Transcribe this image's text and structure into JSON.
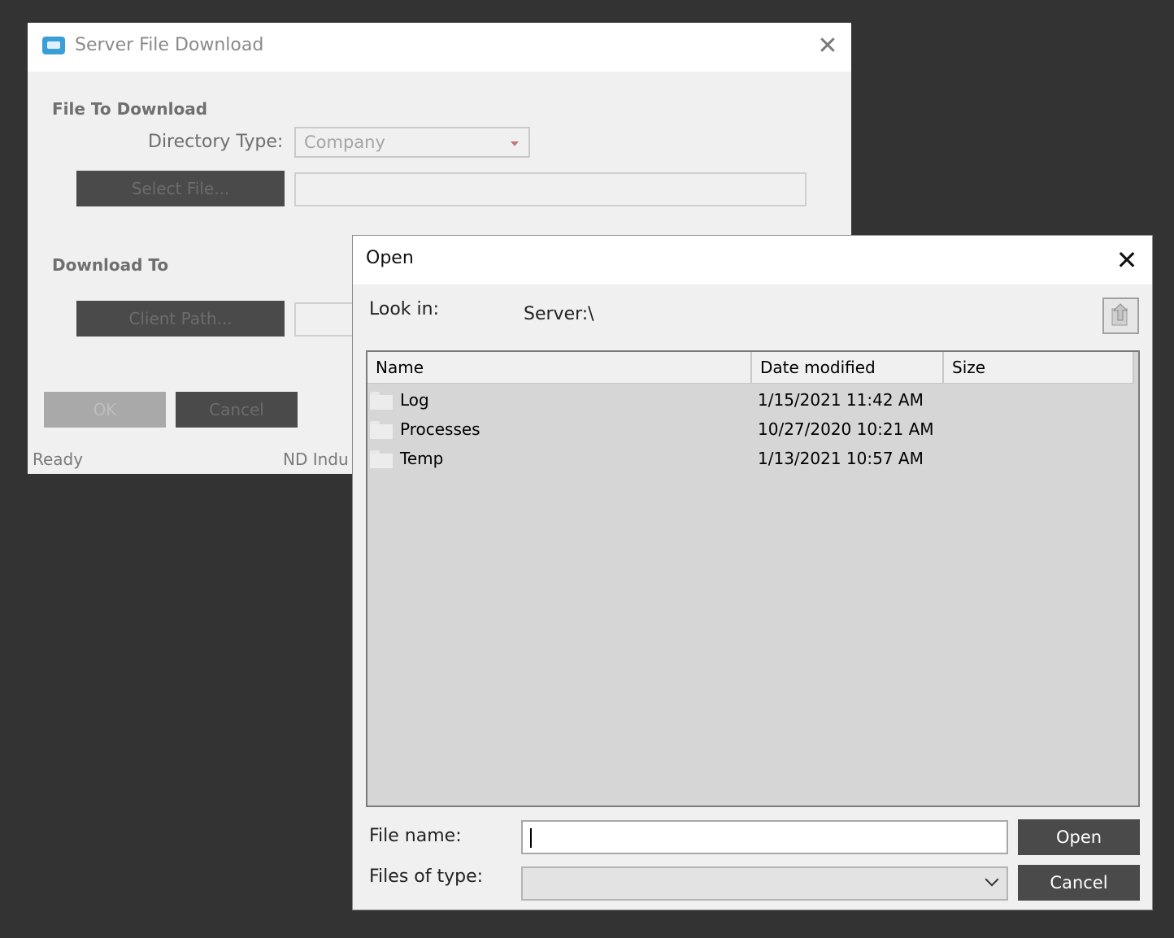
{
  "server_file_download": {
    "title": "Server File Download",
    "close_glyph": "✕",
    "file_to_download_heading": "File To Download",
    "directory_type_label": "Directory Type:",
    "directory_type_value": "Company",
    "select_file_button": "Select File...",
    "select_file_value": "",
    "download_to_heading": "Download To",
    "client_path_button": "Client Path...",
    "client_path_value": "",
    "ok_button": "OK",
    "cancel_button": "Cancel",
    "status_text": "Ready",
    "status_company": "ND Indu"
  },
  "open_dialog": {
    "title": "Open",
    "close_glyph": "✕",
    "look_in_label": "Look in:",
    "look_in_value": "Server:\\",
    "columns": [
      "Name",
      "Date modified",
      "Size"
    ],
    "files": [
      {
        "name": "Log",
        "date": "1/15/2021 11:42 AM",
        "size": "",
        "icon": "folder-icon"
      },
      {
        "name": "Processes",
        "date": "10/27/2020 10:21 AM",
        "size": "",
        "icon": "folder-icon"
      },
      {
        "name": "Temp",
        "date": "1/13/2021 10:57 AM",
        "size": "",
        "icon": "folder-icon"
      }
    ],
    "file_name_label": "File name:",
    "file_name_value": "",
    "files_of_type_label": "Files of type:",
    "files_of_type_value": "",
    "open_button": "Open",
    "cancel_button": "Cancel"
  }
}
